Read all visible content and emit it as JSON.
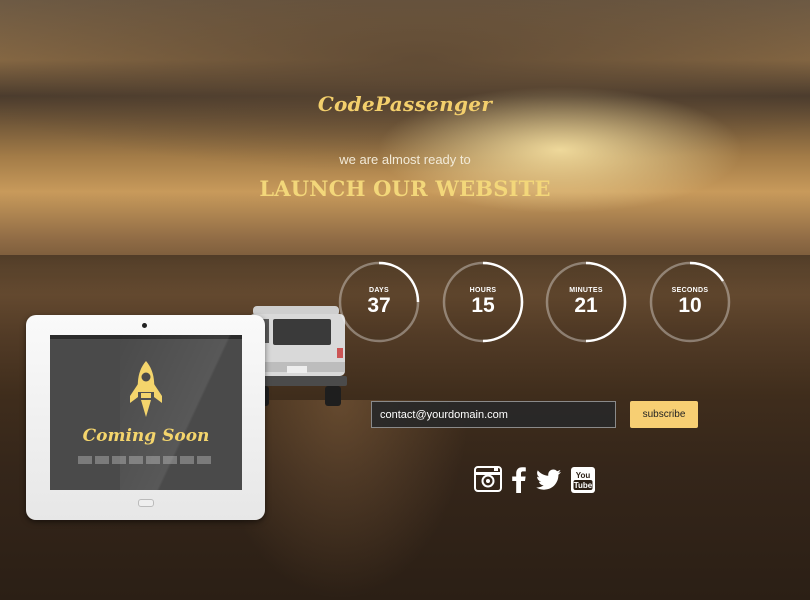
{
  "brand": "CodePassenger",
  "tagline": "we are almost ready to",
  "headline": "LAUNCH OUR WEBSITE",
  "countdown": [
    {
      "label": "DAYS",
      "value": "37"
    },
    {
      "label": "HOURS",
      "value": "15"
    },
    {
      "label": "MINUTES",
      "value": "21"
    },
    {
      "label": "SECONDS",
      "value": "10"
    }
  ],
  "subscribe": {
    "email_value": "contact@yourdomain.com",
    "button_label": "subscribe"
  },
  "social": [
    "camera-icon",
    "facebook-icon",
    "twitter-icon",
    "youtube-icon"
  ],
  "tablet": {
    "coming_soon": "Coming Soon"
  },
  "colors": {
    "accent": "#f3cf6c",
    "button": "#f7cf73"
  }
}
